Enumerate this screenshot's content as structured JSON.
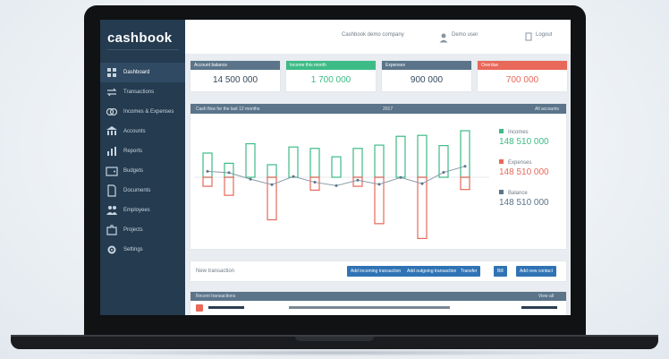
{
  "app": {
    "logo": "cashbook"
  },
  "sidebar": {
    "items": [
      {
        "label": "Dashboard",
        "icon": "dashboard-icon"
      },
      {
        "label": "Transactions",
        "icon": "exchange-icon"
      },
      {
        "label": "Incomes & Expenses",
        "icon": "coins-icon"
      },
      {
        "label": "Accounts",
        "icon": "bank-icon"
      },
      {
        "label": "Reports",
        "icon": "chart-icon"
      },
      {
        "label": "Budgets",
        "icon": "wallet-icon"
      },
      {
        "label": "Documents",
        "icon": "file-icon"
      },
      {
        "label": "Employees",
        "icon": "users-icon"
      },
      {
        "label": "Projects",
        "icon": "puzzle-icon"
      },
      {
        "label": "Settings",
        "icon": "gear-icon"
      }
    ]
  },
  "topbar": {
    "company": "Cashbook demo company",
    "user": "Demo user",
    "logout": "Logout"
  },
  "cards": [
    {
      "label": "Account balance",
      "value": "14 500 000",
      "color": "#5b7489",
      "value_color": "#34495e"
    },
    {
      "label": "Income this month",
      "value": "1 700 000",
      "color": "#3dbb86",
      "value_color": "#3dbb86"
    },
    {
      "label": "Expenses",
      "value": "900 000",
      "color": "#5b7489",
      "value_color": "#34495e"
    },
    {
      "label": "Overdue",
      "value": "700 000",
      "color": "#e8685a",
      "value_color": "#e8685a"
    }
  ],
  "chart_panel": {
    "title": "Cash flow for the last 12 months",
    "period": "2017",
    "right": "All accounts"
  },
  "chart_legend": [
    {
      "label": "Incomes",
      "value": "148 510 000",
      "color": "#3dbb86"
    },
    {
      "label": "Expenses",
      "value": "148 510 000",
      "color": "#e8685a"
    },
    {
      "label": "Balance",
      "value": "148 510 000",
      "color": "#5b7489"
    }
  ],
  "chart_data": {
    "type": "bar",
    "series": [
      {
        "name": "Incomes",
        "values": [
          0.52,
          0.3,
          0.72,
          0.27,
          0.65,
          0.62,
          0.44,
          0.62,
          0.69,
          0.88,
          0.9,
          0.68,
          1.0
        ]
      },
      {
        "name": "Expenses",
        "values": [
          0.14,
          0.28,
          0.0,
          0.66,
          0.0,
          0.2,
          0.0,
          0.14,
          0.72,
          0.0,
          0.95,
          0.0,
          0.19
        ]
      },
      {
        "name": "Balance",
        "values": [
          0.7,
          0.66,
          0.47,
          0.31,
          0.55,
          0.38,
          0.28,
          0.44,
          0.32,
          0.52,
          0.34,
          0.67,
          0.85
        ]
      }
    ]
  },
  "actions": {
    "label": "New transaction",
    "buttons": [
      "Add incoming transaction",
      "Add outgoing transaction",
      "Transfer",
      "Bill",
      "Add new contact"
    ]
  },
  "bottom": {
    "title": "Recent transactions",
    "right": "View all"
  }
}
